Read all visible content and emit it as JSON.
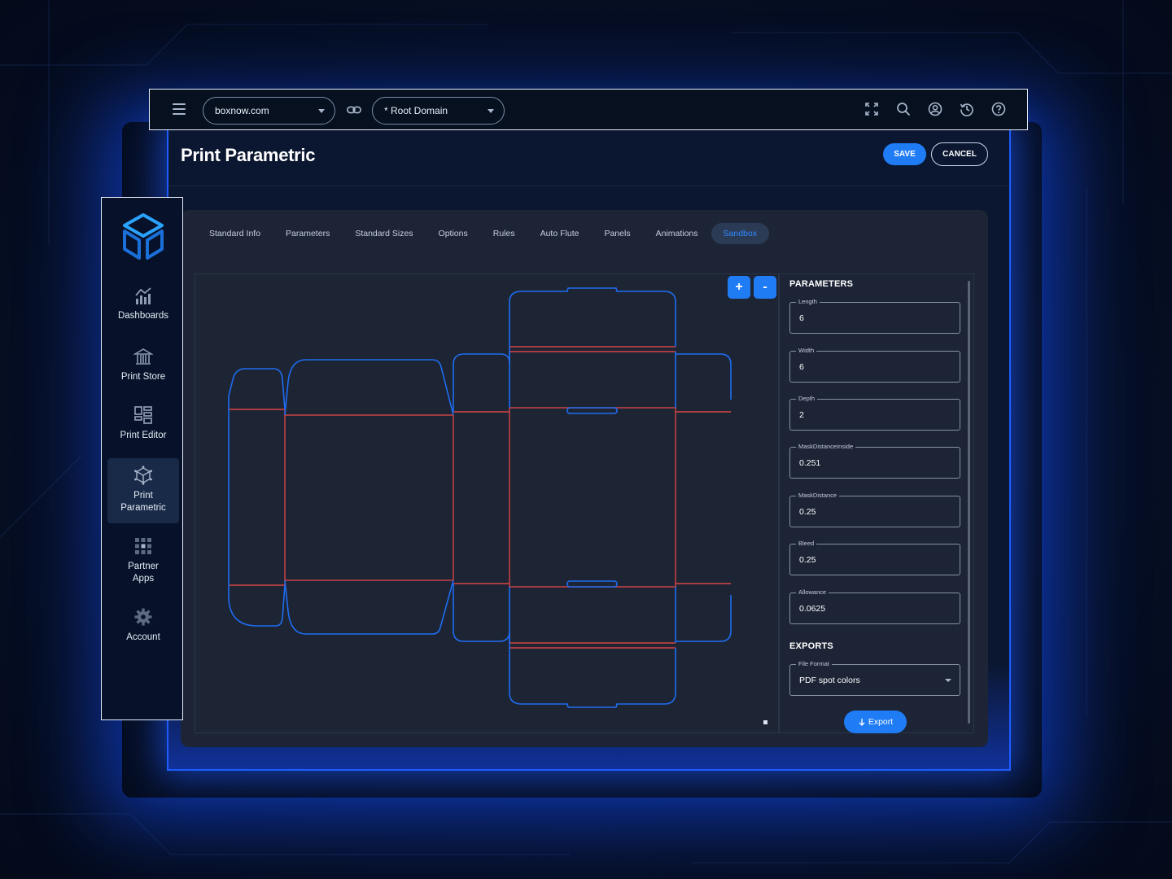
{
  "topbar": {
    "domain_select": "boxnow.com",
    "root_select": "* Root Domain",
    "icons": [
      "fullscreen-icon",
      "search-icon",
      "user-icon",
      "history-icon",
      "help-icon"
    ]
  },
  "sidebar": {
    "items": [
      {
        "label": "Dashboards",
        "icon": "chart-icon"
      },
      {
        "label": "Print Store",
        "icon": "store-icon"
      },
      {
        "label": "Print Editor",
        "icon": "editor-icon"
      },
      {
        "label": "Print Parametric",
        "icon": "parametric-icon",
        "active": true
      },
      {
        "label": "Partner Apps",
        "icon": "grid-icon"
      },
      {
        "label": "Account",
        "icon": "gear-icon"
      }
    ]
  },
  "header": {
    "title": "Print Parametric",
    "save_label": "SAVE",
    "cancel_label": "CANCEL"
  },
  "tabs": [
    {
      "label": "Standard Info"
    },
    {
      "label": "Parameters"
    },
    {
      "label": "Standard Sizes"
    },
    {
      "label": "Options"
    },
    {
      "label": "Rules"
    },
    {
      "label": "Auto Flute"
    },
    {
      "label": "Panels"
    },
    {
      "label": "Animations"
    },
    {
      "label": "Sandbox",
      "active": true
    }
  ],
  "canvas": {
    "zoom_in_label": "+",
    "zoom_out_label": "-",
    "cut_color": "#1f6cf0",
    "fold_color": "#d64545"
  },
  "parameters": {
    "title": "PARAMETERS",
    "fields": [
      {
        "label": "Length",
        "value": "6"
      },
      {
        "label": "Width",
        "value": "6"
      },
      {
        "label": "Depth",
        "value": "2"
      },
      {
        "label": "MaskDistanceInside",
        "value": "0.251"
      },
      {
        "label": "MaskDistance",
        "value": "0.25"
      },
      {
        "label": "Bleed",
        "value": "0.25"
      },
      {
        "label": "Allowance",
        "value": "0.0625"
      }
    ]
  },
  "exports": {
    "title": "EXPORTS",
    "file_format_label": "File Format",
    "file_format_value": "PDF spot colors",
    "export_label": "Export"
  },
  "colors": {
    "accent": "#1f7cf5",
    "active_tab_text": "#2f8bff",
    "panel": "#1c2435",
    "frame_glow": "#1e5cff"
  }
}
